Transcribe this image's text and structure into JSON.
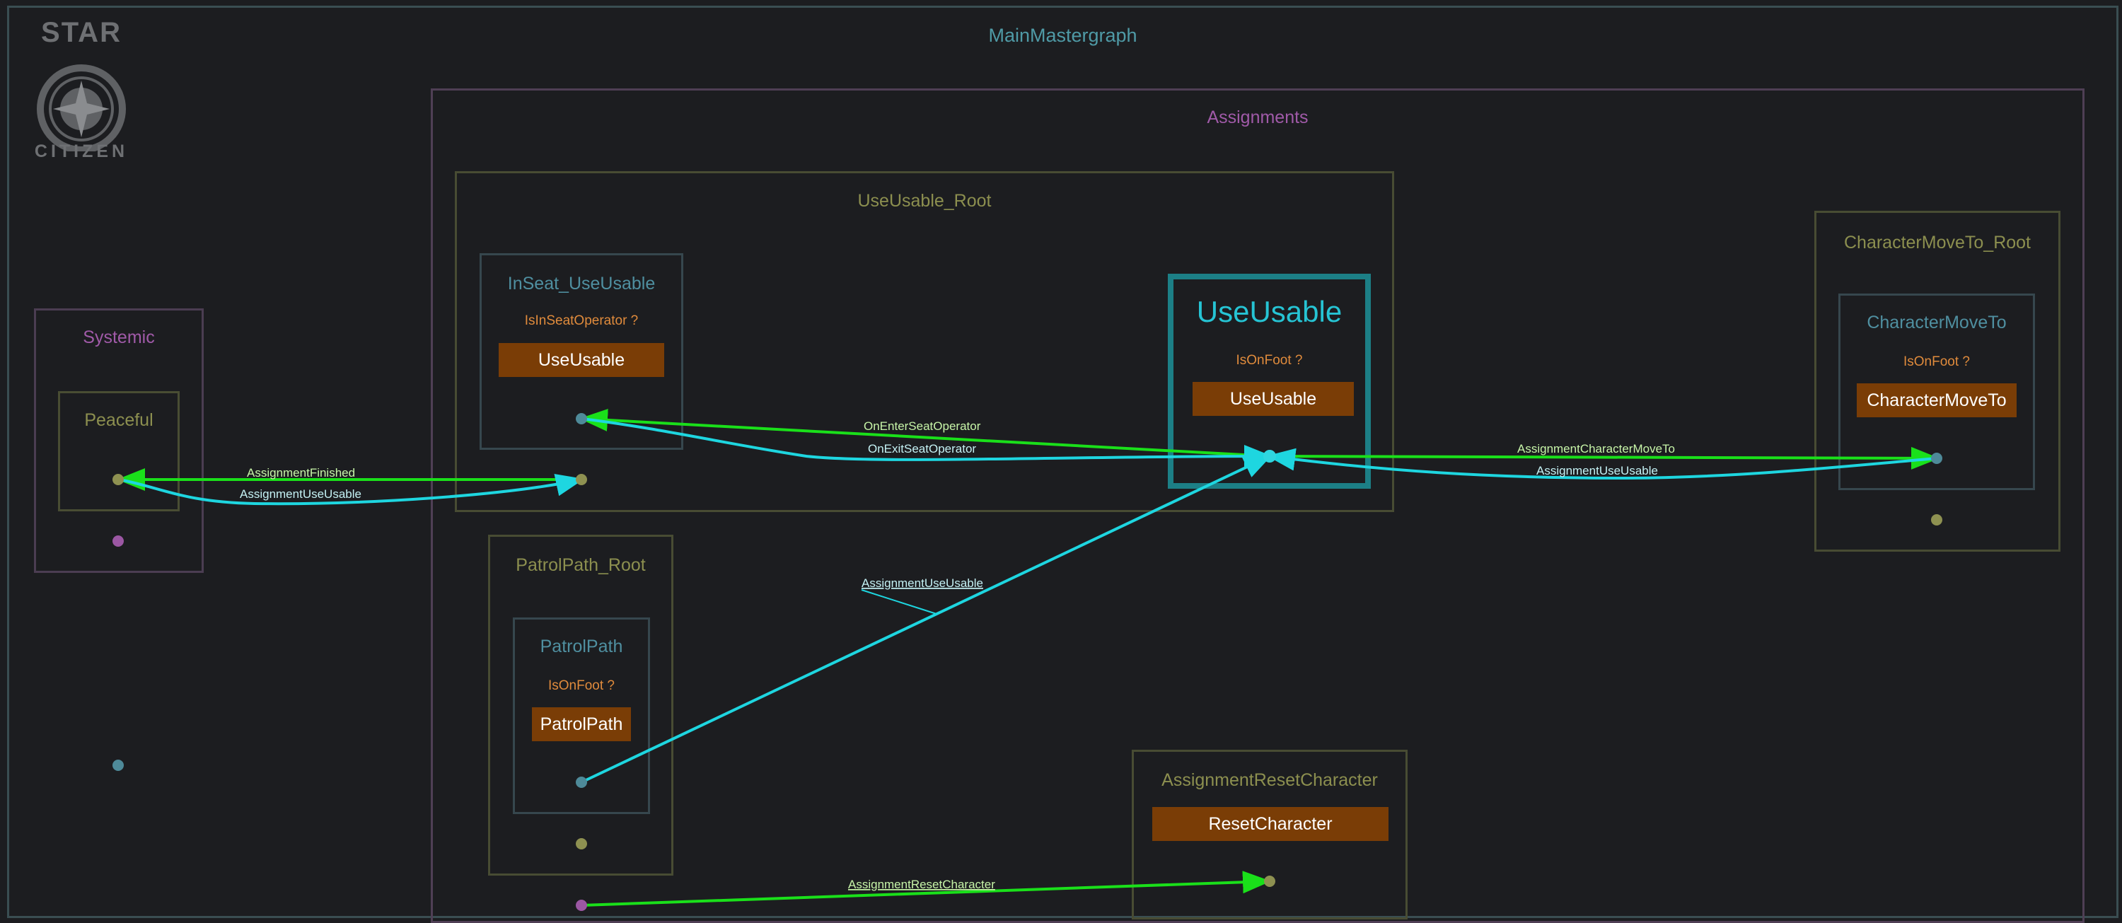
{
  "colors": {
    "background": "#1c1d20",
    "green_edge": "#1ae01a",
    "cyan_edge": "#1ed6e0",
    "condition": "#e08b3c",
    "behavior_fill": "#7a3d06",
    "active_frame": "#1c7f86"
  },
  "logo": {
    "top": "STAR",
    "bottom": "CITIZEN"
  },
  "graph": {
    "main_title": "MainMastergraph",
    "assignments_title": "Assignments",
    "systemic": {
      "title": "Systemic",
      "peaceful": "Peaceful"
    },
    "useusable_root": {
      "title": "UseUsable_Root",
      "inseat": {
        "title": "InSeat_UseUsable",
        "condition": "IsInSeatOperator ?",
        "behavior": "UseUsable"
      },
      "useusable": {
        "title": "UseUsable",
        "condition": "IsOnFoot ?",
        "behavior": "UseUsable"
      }
    },
    "charmove_root": {
      "title": "CharacterMoveTo_Root",
      "charmove": {
        "title": "CharacterMoveTo",
        "condition": "IsOnFoot ?",
        "behavior": "CharacterMoveTo"
      }
    },
    "patrol_root": {
      "title": "PatrolPath_Root",
      "patrol": {
        "title": "PatrolPath",
        "condition": "IsOnFoot ?",
        "behavior": "PatrolPath"
      }
    },
    "reset": {
      "title": "AssignmentResetCharacter",
      "behavior": "ResetCharacter"
    }
  },
  "edges": {
    "assignment_finished": "AssignmentFinished",
    "assignment_useusable_left": "AssignmentUseUsable",
    "on_enter_seat": "OnEnterSeatOperator",
    "on_exit_seat": "OnExitSeatOperator",
    "assignment_charmove": "AssignmentCharacterMoveTo",
    "assignment_useusable_right": "AssignmentUseUsable",
    "assignment_useusable_patrol": "AssignmentUseUsable",
    "assignment_reset": "AssignmentResetCharacter"
  }
}
